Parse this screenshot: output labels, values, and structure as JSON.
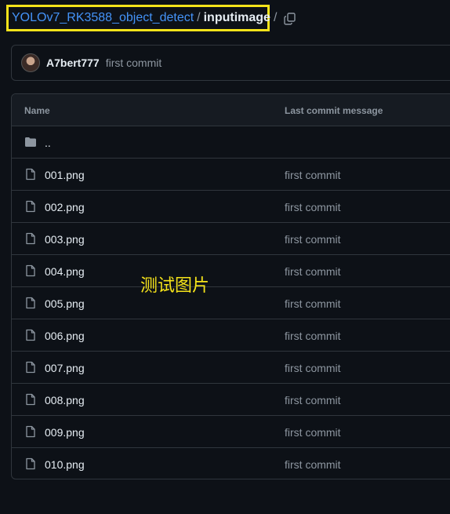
{
  "breadcrumb": {
    "repo": "YOLOv7_RK3588_object_detect",
    "separator": "/",
    "folder": "inputimage",
    "trailing": "/"
  },
  "commit": {
    "author": "A7bert777",
    "message": "first commit"
  },
  "table": {
    "headers": {
      "name": "Name",
      "message": "Last commit message"
    },
    "parent_dir": "..",
    "rows": [
      {
        "name": "001.png",
        "message": "first commit"
      },
      {
        "name": "002.png",
        "message": "first commit"
      },
      {
        "name": "003.png",
        "message": "first commit"
      },
      {
        "name": "004.png",
        "message": "first commit"
      },
      {
        "name": "005.png",
        "message": "first commit"
      },
      {
        "name": "006.png",
        "message": "first commit"
      },
      {
        "name": "007.png",
        "message": "first commit"
      },
      {
        "name": "008.png",
        "message": "first commit"
      },
      {
        "name": "009.png",
        "message": "first commit"
      },
      {
        "name": "010.png",
        "message": "first commit"
      }
    ]
  },
  "annotation": "测试图片",
  "icons": {
    "copy": "copy-icon",
    "folder": "folder-icon",
    "file": "file-icon"
  },
  "colors": {
    "background": "#0d1117",
    "link": "#4493f8",
    "highlight": "#f5e31a",
    "muted": "#8d96a0",
    "border": "#30363d"
  }
}
